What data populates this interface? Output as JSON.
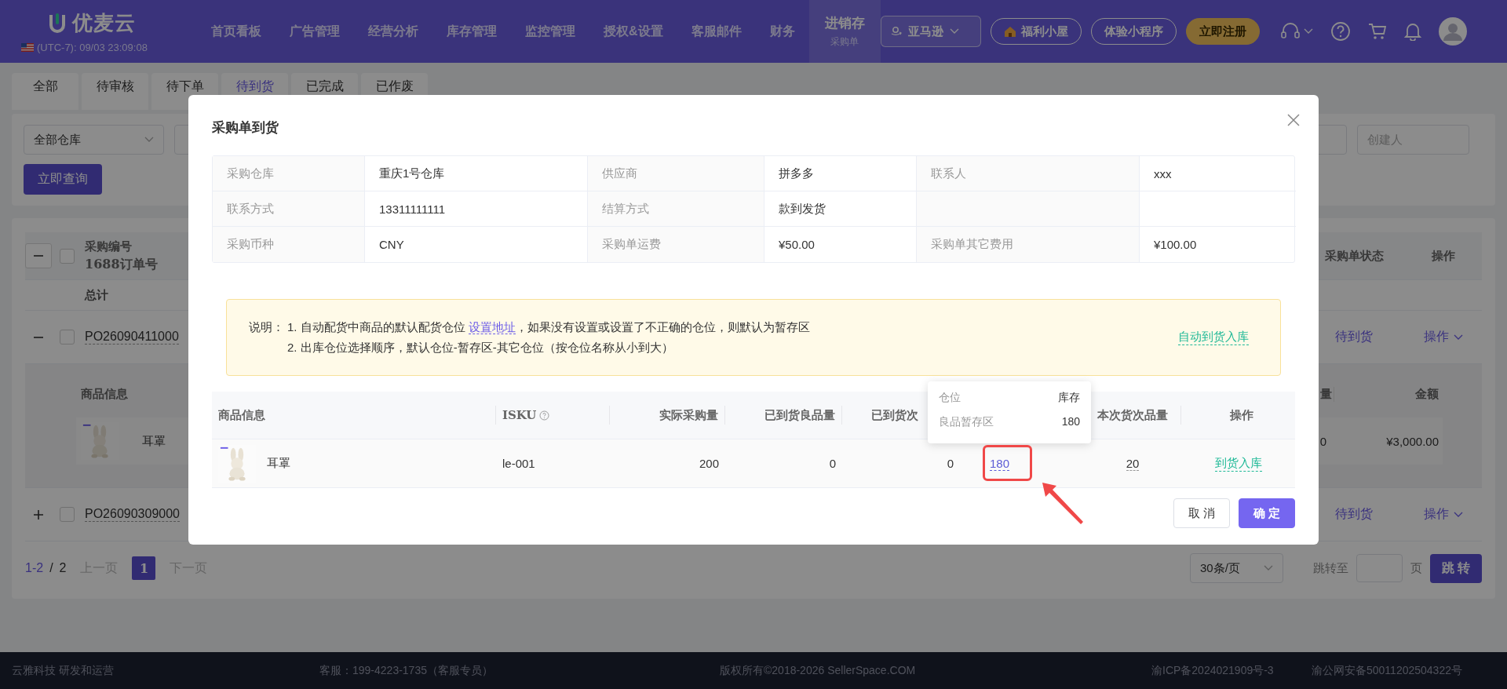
{
  "nav": {
    "logo": "优麦云",
    "clock": "(UTC-7): 09/03 23:09:08",
    "menu": [
      {
        "label": "首页看板",
        "selected": false
      },
      {
        "label": "广告管理",
        "selected": false
      },
      {
        "label": "经营分析",
        "selected": false
      },
      {
        "label": "库存管理",
        "selected": false
      },
      {
        "label": "监控管理",
        "selected": false
      },
      {
        "label": "授权&设置",
        "selected": false
      },
      {
        "label": "客服邮件",
        "selected": false
      },
      {
        "label": "财务",
        "selected": false
      },
      {
        "label": "进销存",
        "selected": true,
        "sub": "采购单"
      }
    ],
    "marketplace": "亚马逊",
    "buttons": [
      {
        "kind": "welfare",
        "label": "福利小屋"
      },
      {
        "kind": "outline",
        "label": "体验小程序"
      },
      {
        "kind": "primary",
        "label": "立即注册"
      }
    ]
  },
  "tabs": [
    {
      "label": "全部",
      "selected": false
    },
    {
      "label": "待审核",
      "selected": false
    },
    {
      "label": "待下单",
      "selected": false
    },
    {
      "label": "待到货",
      "selected": true
    },
    {
      "label": "已完成",
      "selected": false
    },
    {
      "label": "已作废",
      "selected": false
    }
  ],
  "filters": {
    "warehouse": "全部仓库",
    "creator_placeholder": "创建人",
    "query_button": "立即查询"
  },
  "orders_table": {
    "expanded": true,
    "checked": false,
    "columns": {
      "order_no": "采购编号",
      "order_no_sub": "1688订单号",
      "status": "采购单状态",
      "actions": "操作"
    },
    "total_label": "总计",
    "rows": [
      {
        "expanded": true,
        "checked": false,
        "order_no": "PO26090411000",
        "status": "待到货",
        "action": "操作",
        "items_columns": {
          "product": "商品信息",
          "quantity": "量",
          "amount": "金额"
        },
        "items": [
          {
            "name": "耳罩",
            "quantity": "0",
            "amount": "¥3,000.00"
          }
        ]
      },
      {
        "expanded": false,
        "checked": false,
        "order_no": "PO26090309000",
        "status": "待到货",
        "action": "操作"
      }
    ]
  },
  "pagination": {
    "range": "1-2",
    "separator": "/",
    "total": "2",
    "prev": "上一页",
    "current": "1",
    "next": "下一页",
    "page_size": "30条/页",
    "goto_label": "跳转至",
    "page_unit": "页",
    "goto_button": "跳 转"
  },
  "dialog": {
    "title": "采购单到货",
    "info": [
      [
        {
          "label": "采购仓库",
          "value": "重庆1号仓库"
        },
        {
          "label": "供应商",
          "value": "拼多多"
        },
        {
          "label": "联系人",
          "value": "xxx"
        }
      ],
      [
        {
          "label": "联系方式",
          "value": "13311111111"
        },
        {
          "label": "结算方式",
          "value": "款到发货"
        }
      ],
      [
        {
          "label": "采购币种",
          "value": "CNY"
        },
        {
          "label": "采购单运费",
          "value": "¥50.00"
        },
        {
          "label": "采购单其它费用",
          "value": "¥100.00"
        }
      ]
    ],
    "notice": {
      "prefix": "说明：",
      "lines": [
        {
          "number": "1.",
          "text": "自动配货中商品的默认配货仓位 ",
          "link": "设置地址",
          "text_after": "，如果没有设置或设置了不正确的仓位，则默认为暂存区"
        },
        {
          "number": "2.",
          "text": "出库仓位选择顺序，默认仓位-暂存区-其它仓位（按仓位名称从小到大）"
        }
      ],
      "action": "自动到货入库"
    },
    "columns": [
      {
        "label": "商品信息"
      },
      {
        "label": "ISKU",
        "help": true
      },
      {
        "label": "实际采购量"
      },
      {
        "label": "已到货良品量"
      },
      {
        "label": "已到货次"
      },
      {},
      {
        "label": "本次货次品量"
      },
      {
        "label": "操作"
      }
    ],
    "rows": [
      {
        "name": "耳罩",
        "isku": "le-001",
        "ordered": "200",
        "received_good": "0",
        "received_defective": "0",
        "stock": "180",
        "defective_now": "20",
        "action": "到货入库"
      }
    ],
    "tooltip": {
      "columns": [
        "仓位",
        "库存"
      ],
      "rows": [
        [
          "良品暂存区",
          "180"
        ]
      ]
    },
    "buttons": [
      {
        "kind": "cancel",
        "label": "取 消"
      },
      {
        "kind": "confirm",
        "label": "确 定"
      }
    ]
  },
  "footer": {
    "company": "云雅科技 研发和运营",
    "service": "客服：199-4223-1735（客服专员）",
    "copyright": "版权所有©2018-2026 SellerSpace.COM",
    "icp": "渝ICP备2024021909号-3",
    "police": "渝公网安备50011202504322号"
  }
}
